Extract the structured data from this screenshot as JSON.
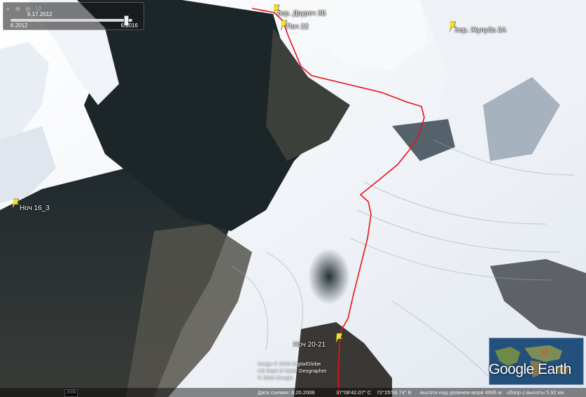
{
  "timebar": {
    "icons": "⌕ ⊕ ⊖ ↺",
    "top_date": "6.17.2012",
    "start_date": "6.2012",
    "end_date": "6.2016"
  },
  "markers": [
    {
      "label": "пер. Двуреч 3Б"
    },
    {
      "label": "Поч 22"
    },
    {
      "label": "пер. Жулуба 3А"
    },
    {
      "label": "Ноч 16_3"
    },
    {
      "label": "Ноч 20-21"
    }
  ],
  "credits": {
    "line1": "Image © 2016 DigitalGlobe",
    "line2": "US Dept of State Geographer",
    "line3": "© 2016 Google"
  },
  "year_badge": "2008",
  "status": {
    "date": "Дата съемки: 8.20.2008",
    "lat": "37°08'42.07\" С",
    "lon": "72°25'58.74\" В",
    "elev": "высота над уровнем моря 4995 м",
    "eye": "обзор с высоты 5.92 км"
  },
  "logo": "Google Earth",
  "colors": {
    "route": "#e8121a",
    "pin": "#f4e12a",
    "snow": "#f3f6fa",
    "rock": "#2a2d2c"
  }
}
